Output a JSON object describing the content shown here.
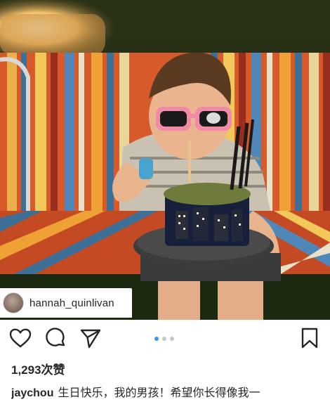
{
  "post": {
    "username": "hannah_quinlivan",
    "likes_text": "1,293次赞",
    "caption_author": "jaychou",
    "caption_text": "生日快乐，我的男孩！希望你长得像我一",
    "carousel": {
      "count": 3,
      "active_index": 0
    }
  },
  "icons": {
    "like": "heart-icon",
    "comment": "comment-icon",
    "share": "send-icon",
    "save": "bookmark-icon"
  },
  "colors": {
    "accent_blue": "#3897f0",
    "text": "#262626"
  }
}
